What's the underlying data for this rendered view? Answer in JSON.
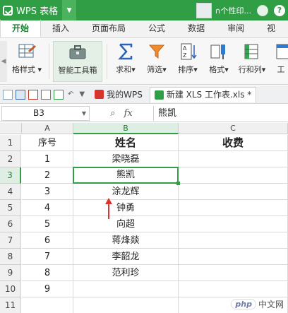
{
  "app": {
    "title": "WPS 表格",
    "user_label": "∩个性印...",
    "help": "?"
  },
  "tabs": [
    "开始",
    "插入",
    "页面布局",
    "公式",
    "数据",
    "审阅",
    "视"
  ],
  "ribbon": {
    "format_style": "格样式",
    "smart_toolbox": "智能工具箱",
    "sum": "求和",
    "filter": "筛选",
    "sort": "排序",
    "format": "格式",
    "row_col": "行和列",
    "more": "工"
  },
  "doc_tabs": {
    "wps_tab": "我的WPS",
    "file_tab": "新建 XLS 工作表.xls *"
  },
  "formula_bar": {
    "cell_ref": "B3",
    "fx": "fx",
    "value": "熊凯"
  },
  "grid": {
    "columns": [
      "A",
      "B",
      "C"
    ],
    "row_numbers": [
      "1",
      "2",
      "3",
      "4",
      "5",
      "6",
      "7",
      "8",
      "9",
      "10",
      "11"
    ],
    "rows": [
      [
        "序号",
        "姓名",
        "收费"
      ],
      [
        "1",
        "梁晓磊",
        ""
      ],
      [
        "2",
        "熊凯",
        ""
      ],
      [
        "3",
        "涂龙辉",
        ""
      ],
      [
        "4",
        "钟勇",
        ""
      ],
      [
        "5",
        "向超",
        ""
      ],
      [
        "6",
        "蒋烽燚",
        ""
      ],
      [
        "7",
        "李韶龙",
        ""
      ],
      [
        "8",
        "范利珍",
        ""
      ],
      [
        "9",
        "",
        ""
      ],
      [
        "",
        "",
        ""
      ]
    ]
  },
  "watermark": {
    "logo": "php",
    "text": "中文网"
  },
  "colors": {
    "accent": "#2f9e44",
    "arrow": "#e03131"
  }
}
